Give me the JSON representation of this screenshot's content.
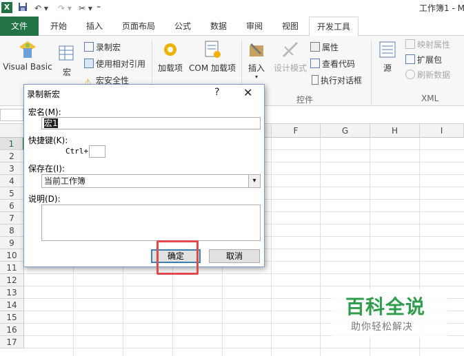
{
  "title_bar": {
    "title": "工作簿1 - M"
  },
  "tabs": [
    {
      "label": "文件"
    },
    {
      "label": "开始"
    },
    {
      "label": "插入"
    },
    {
      "label": "页面布局"
    },
    {
      "label": "公式"
    },
    {
      "label": "数据"
    },
    {
      "label": "审阅"
    },
    {
      "label": "视图"
    },
    {
      "label": "开发工具"
    }
  ],
  "ribbon": {
    "visual_basic": "Visual Basic",
    "macro": "宏",
    "record_macro": "录制宏",
    "use_relative": "使用相对引用",
    "macro_security": "宏安全性",
    "addins": "加载项",
    "com_addins": "COM 加载项",
    "insert": "插入",
    "design_mode": "设计模式",
    "properties": "属性",
    "view_code": "查看代码",
    "run_dialog": "执行对话框",
    "controls_group": "控件",
    "source": "源",
    "map_props": "映射属性",
    "expansion": "扩展包",
    "refresh": "刷新数据",
    "xml_group": "XML"
  },
  "columns": [
    "F",
    "G",
    "H",
    "I"
  ],
  "rows": [
    "1",
    "2",
    "3",
    "4",
    "5",
    "6",
    "7",
    "8",
    "9",
    "10",
    "11",
    "12",
    "13",
    "14",
    "15",
    "16",
    "17"
  ],
  "dialog": {
    "title": "录制新宏",
    "help": "?",
    "close": "✕",
    "name_label": "宏名(M):",
    "name_value": "宏1",
    "shortcut_label": "快捷键(K):",
    "ctrl_label": "Ctrl+",
    "shortcut_value": "",
    "store_label": "保存在(I):",
    "store_value": "当前工作簿",
    "desc_label": "说明(D):",
    "desc_value": "",
    "ok": "确定",
    "cancel": "取消"
  },
  "watermark": {
    "line1": "百科全说",
    "line2": "助你轻松解决"
  },
  "colors": {
    "excel_green": "#217346",
    "highlight_red": "#e04a4a",
    "watermark_green": "#2e9c4a"
  }
}
